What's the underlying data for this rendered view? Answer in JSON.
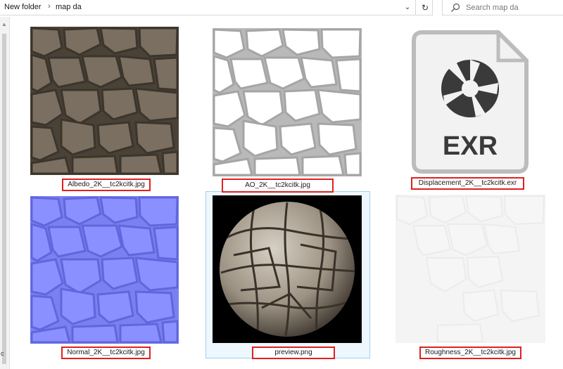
{
  "breadcrumb": {
    "parent": "New folder",
    "current": "map da"
  },
  "search": {
    "placeholder": "Search map da"
  },
  "icons": {
    "breadcrumb_separator": "chevron-right-icon",
    "address_dropdown": "chevron-down-icon",
    "refresh": "refresh-icon",
    "search": "search-icon",
    "scroll_up": "scroll-up-arrow-icon"
  },
  "stray_char": "c",
  "files": [
    {
      "name": "Albedo_2K__tc2kcitk.jpg",
      "type": "image"
    },
    {
      "name": "AO_2K__tc2kcitk.jpg",
      "type": "image"
    },
    {
      "name": "Displacement_2K__tc2kcitk.exr",
      "type": "exr",
      "icon_text": "EXR"
    },
    {
      "name": "Normal_2K__tc2kcitk.jpg",
      "type": "image"
    },
    {
      "name": "preview.png",
      "type": "image",
      "selected": true
    },
    {
      "name": "Roughness_2K__tc2kcitk.jpg",
      "type": "image"
    }
  ],
  "colors": {
    "highlight_border": "#e02020",
    "selection_fill": "#eef7fd",
    "selection_border": "#9fd1f0"
  }
}
